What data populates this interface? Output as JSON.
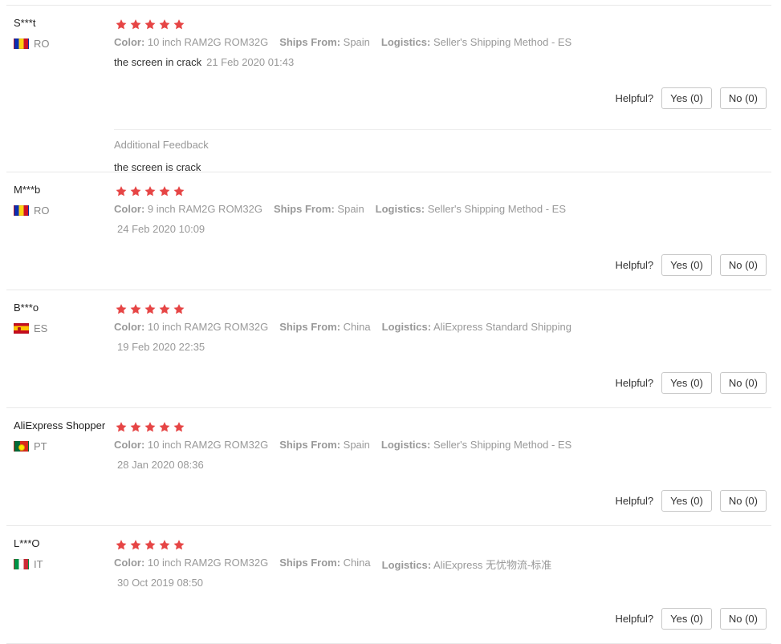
{
  "labels": {
    "color": "Color:",
    "ships_from": "Ships From:",
    "logistics": "Logistics:",
    "helpful": "Helpful?",
    "additional_feedback": "Additional Feedback"
  },
  "colors": {
    "star": "#e64545",
    "rule": "#e8e8e8"
  },
  "reviews": [
    {
      "user": "S***t",
      "country_code": "RO",
      "flag_icon": "romania-flag-icon",
      "stars": 5,
      "color": "10 inch RAM2G ROM32G",
      "ships_from": "Spain",
      "logistics": "Seller's Shipping Method - ES",
      "text": "the screen in crack",
      "date": "21 Feb 2020 01:43",
      "yes": "Yes (0)",
      "no": "No (0)",
      "additional_feedback": "the screen is crack"
    },
    {
      "user": "M***b",
      "country_code": "RO",
      "flag_icon": "romania-flag-icon",
      "stars": 5,
      "color": "9 inch RAM2G ROM32G",
      "ships_from": "Spain",
      "logistics": "Seller's Shipping Method - ES",
      "date": "24 Feb 2020 10:09",
      "yes": "Yes (0)",
      "no": "No (0)"
    },
    {
      "user": "B***o",
      "country_code": "ES",
      "flag_icon": "spain-flag-icon",
      "stars": 5,
      "color": "10 inch RAM2G ROM32G",
      "ships_from": "China",
      "logistics": "AliExpress Standard Shipping",
      "date": "19 Feb 2020 22:35",
      "yes": "Yes (0)",
      "no": "No (0)"
    },
    {
      "user": "AliExpress Shopper",
      "country_code": "PT",
      "flag_icon": "portugal-flag-icon",
      "stars": 5,
      "color": "10 inch RAM2G ROM32G",
      "ships_from": "Spain",
      "logistics": "Seller's Shipping Method - ES",
      "date": "28 Jan 2020 08:36",
      "yes": "Yes (0)",
      "no": "No (0)"
    },
    {
      "user": "L***O",
      "country_code": "IT",
      "flag_icon": "italy-flag-icon",
      "stars": 5,
      "color": "10 inch RAM2G ROM32G",
      "ships_from": "China",
      "logistics": "AliExpress 无忧物流-标准",
      "date": "30 Oct 2019 08:50",
      "yes": "Yes (0)",
      "no": "No (0)"
    }
  ]
}
